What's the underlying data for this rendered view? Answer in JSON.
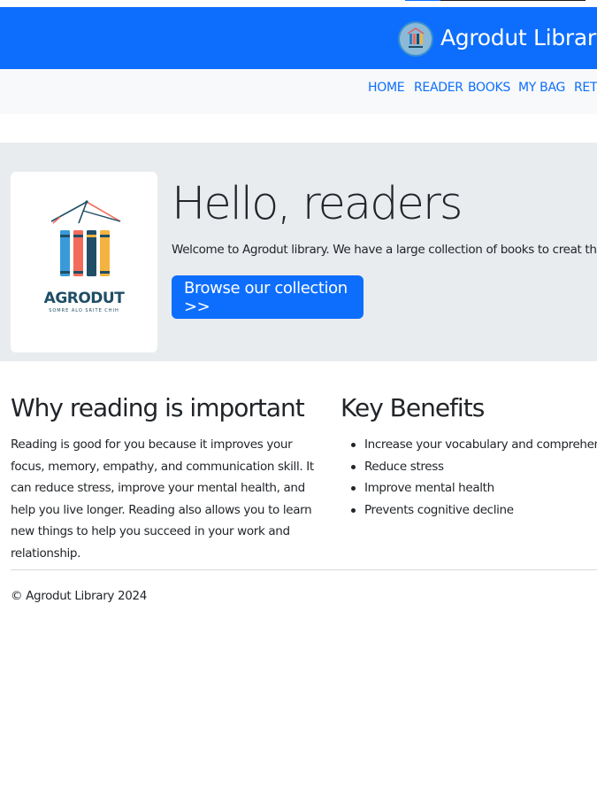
{
  "header": {
    "brand_title": "Agrodut Library",
    "brand_color": "#0d6efd",
    "logo_icon": "agrodut-logo-icon"
  },
  "nav": {
    "items": [
      {
        "label": "HOME"
      },
      {
        "label": "READER"
      },
      {
        "label": "BOOKS"
      },
      {
        "label": "MY BAG"
      },
      {
        "label": "RETU"
      }
    ],
    "link_color": "#0d6efd"
  },
  "hero": {
    "title": "Hello, readers",
    "text": "Welcome to Agrodut library. We have a large collection of books to creat the rea",
    "button_label": "Browse our collection >>",
    "logo": {
      "name": "AGRODUT",
      "tagline": "SOMRE ALO SRITE CHIH",
      "book_colors": [
        "#3a9ad9",
        "#f26b5b",
        "#1f4e66",
        "#f4b340"
      ]
    },
    "background": "#e9ecef"
  },
  "why": {
    "heading": "Why reading is important",
    "body": "Reading is good for you because it improves your focus, memory, empathy, and communication skill. It can reduce stress, improve your mental health, and help you live longer. Reading also allows you to learn new things to help you succeed in your work and relationship."
  },
  "benefits": {
    "heading": "Key Benefits",
    "items": [
      {
        "text": "Increase your vocabulary and comprehensio"
      },
      {
        "text": "Reduce stress"
      },
      {
        "text": "Improve mental health"
      },
      {
        "text": "Prevents cognitive decline"
      }
    ]
  },
  "footer": {
    "text": "© Agrodut Library 2024"
  }
}
